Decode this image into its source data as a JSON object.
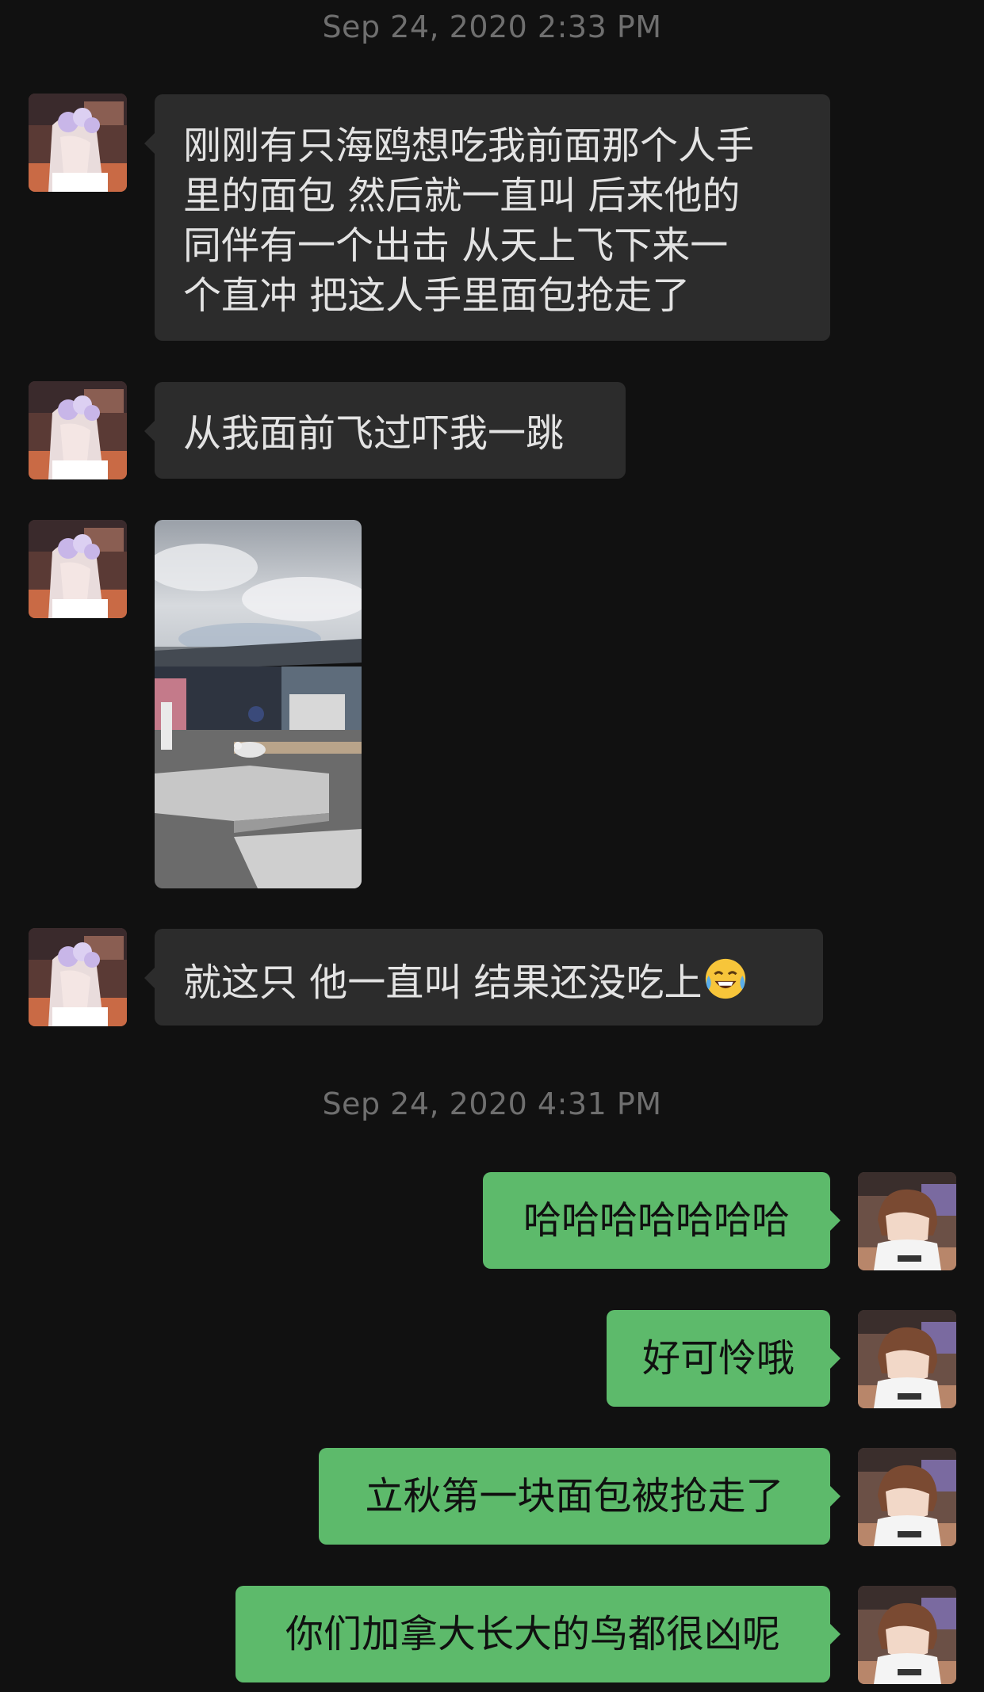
{
  "chat": {
    "timestamps": [
      "Sep 24, 2020 2:33 PM",
      "Sep 24, 2020 4:31 PM"
    ],
    "incoming": [
      "刚刚有只海鸥想吃我前面那个人手里的面包 然后就一直叫  后来他的同伴有一个出击 从天上飞下来一个直冲 把这人手里面包抢走了",
      "从我面前飞过吓我一跳",
      "就这只 他一直叫 结果还没吃上"
    ],
    "incoming_lines": [
      [
        "刚刚有只海鸥想吃我前面那个人手",
        "里的面包 然后就一直叫  后来他的",
        "同伴有一个出击 从天上飞下来一",
        "个直冲 把这人手里面包抢走了"
      ]
    ],
    "emoji_name": "tears-of-joy-emoji",
    "photo_name": "seagull-photo",
    "outgoing": [
      "哈哈哈哈哈哈哈",
      "好可怜哦",
      "立秋第一块面包被抢走了",
      "你们加拿大长大的鸟都很凶呢"
    ]
  },
  "colors": {
    "background": "#111111",
    "incoming_bubble": "#2c2c2c",
    "outgoing_bubble": "#5dba6b",
    "timestamp": "#6f6f6f"
  }
}
